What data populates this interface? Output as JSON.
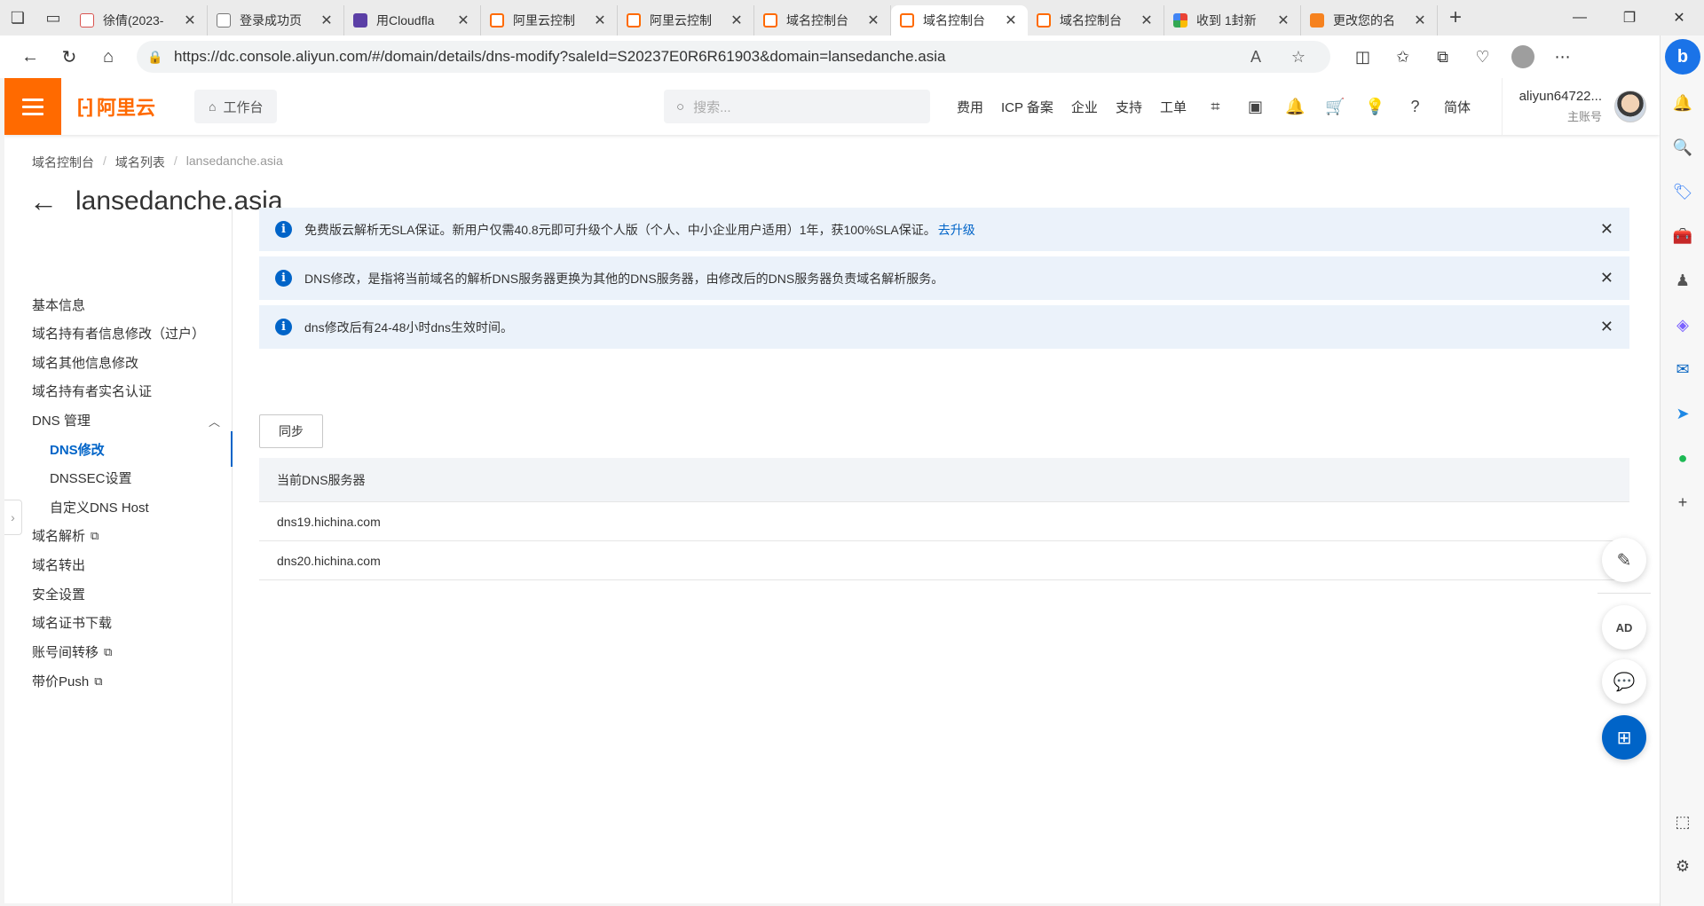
{
  "browser": {
    "tabs": [
      {
        "label": "徐倩(2023-",
        "favicon": "pdf-icon"
      },
      {
        "label": "登录成功页",
        "favicon": "document-icon"
      },
      {
        "label": "用Cloudfla",
        "favicon": "cloudflare-icon"
      },
      {
        "label": "阿里云控制",
        "favicon": "aliyun-icon"
      },
      {
        "label": "阿里云控制",
        "favicon": "aliyun-icon"
      },
      {
        "label": "域名控制台",
        "favicon": "aliyun-icon"
      },
      {
        "label": "域名控制台",
        "favicon": "aliyun-icon",
        "active": true
      },
      {
        "label": "域名控制台",
        "favicon": "aliyun-icon"
      },
      {
        "label": "收到 1封新",
        "favicon": "google-icon"
      },
      {
        "label": "更改您的名",
        "favicon": "cloud-icon"
      }
    ],
    "url": "https://dc.console.aliyun.com/#/domain/details/dns-modify?saleId=S20237E0R6R61903&domain=lansedanche.asia"
  },
  "header": {
    "logo_text": "阿里云",
    "workbench_label": "工作台",
    "search_placeholder": "搜索...",
    "menu": [
      "费用",
      "ICP 备案",
      "企业",
      "支持",
      "工单"
    ],
    "lang_label": "简体",
    "username": "aliyun64722...",
    "account_role": "主账号"
  },
  "breadcrumb": {
    "items": [
      "域名控制台",
      "域名列表",
      "lansedanche.asia"
    ]
  },
  "page": {
    "title": "lansedanche.asia"
  },
  "sidebar": {
    "items": [
      {
        "label": "基本信息"
      },
      {
        "label": "域名持有者信息修改（过户）"
      },
      {
        "label": "域名其他信息修改"
      },
      {
        "label": "域名持有者实名认证"
      },
      {
        "label": "DNS 管理"
      },
      {
        "label": "DNS修改"
      },
      {
        "label": "DNSSEC设置"
      },
      {
        "label": "自定义DNS Host"
      },
      {
        "label": "域名解析"
      },
      {
        "label": "域名转出"
      },
      {
        "label": "安全设置"
      },
      {
        "label": "域名证书下载"
      },
      {
        "label": "账号间转移"
      },
      {
        "label": "带价Push"
      }
    ]
  },
  "alerts": [
    {
      "text": "免费版云解析无SLA保证。新用户仅需40.8元即可升级个人版（个人、中小企业用户适用）1年，获100%SLA保证。",
      "link": "去升级"
    },
    {
      "text": "DNS修改，是指将当前域名的解析DNS服务器更换为其他的DNS服务器，由修改后的DNS服务器负责域名解析服务。"
    },
    {
      "text": "dns修改后有24-48小时dns生效时间。"
    }
  ],
  "actions": {
    "sync_label": "同步"
  },
  "dns_table": {
    "header": "当前DNS服务器",
    "rows": [
      "dns19.hichina.com",
      "dns20.hichina.com"
    ]
  },
  "colors": {
    "brand": "#ff6a00",
    "accent": "#0064c8",
    "alert_bg": "#ebf2fa"
  }
}
